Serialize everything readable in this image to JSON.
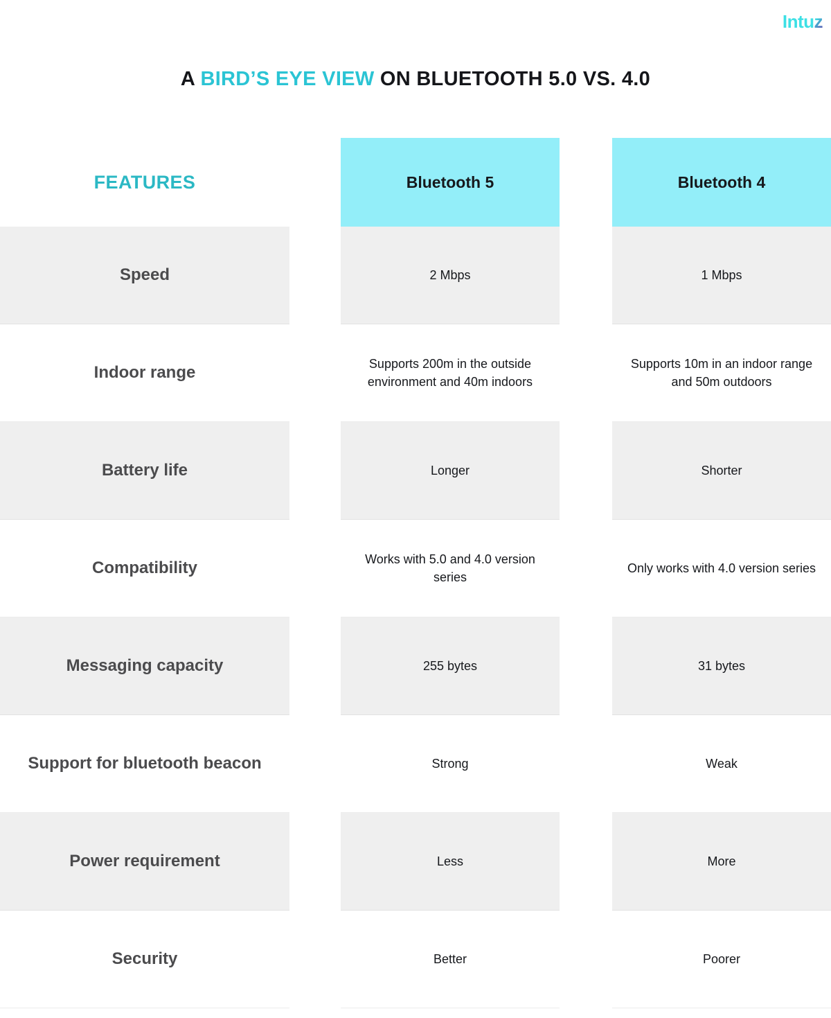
{
  "brand": {
    "logo_text_main": "Intu",
    "logo_text_accent": "z",
    "accent_color": "#3DE0E5",
    "accent_dark": "#5B3FA8"
  },
  "title": {
    "lead": "A ",
    "highlight": "BIRD’S EYE VIEW",
    "tail": " ON BLUETOOTH 5.0 VS. 4.0",
    "highlight_color": "#2BC4D4"
  },
  "table": {
    "headers": {
      "features": "FEATURES",
      "col1": "Bluetooth 5",
      "col2": "Bluetooth 4",
      "header_bg": "#93EEF9",
      "features_color": "#2BB8C4"
    },
    "rows": [
      {
        "feature": "Speed",
        "bt5": "2 Mbps",
        "bt4": "1 Mbps"
      },
      {
        "feature": "Indoor range",
        "bt5": "Supports 200m in the outside environment and 40m indoors",
        "bt4": "Supports 10m in an indoor range and 50m outdoors"
      },
      {
        "feature": "Battery life",
        "bt5": "Longer",
        "bt4": "Shorter"
      },
      {
        "feature": "Compatibility",
        "bt5": "Works with 5.0 and 4.0 version series",
        "bt4": "Only works with 4.0 version series"
      },
      {
        "feature": "Messaging capacity",
        "bt5": "255 bytes",
        "bt4": "31 bytes"
      },
      {
        "feature": "Support for bluetooth beacon",
        "bt5": "Strong",
        "bt4": "Weak"
      },
      {
        "feature": "Power requirement",
        "bt5": "Less",
        "bt4": "More"
      },
      {
        "feature": "Security",
        "bt5": "Better",
        "bt4": "Poorer"
      }
    ]
  }
}
